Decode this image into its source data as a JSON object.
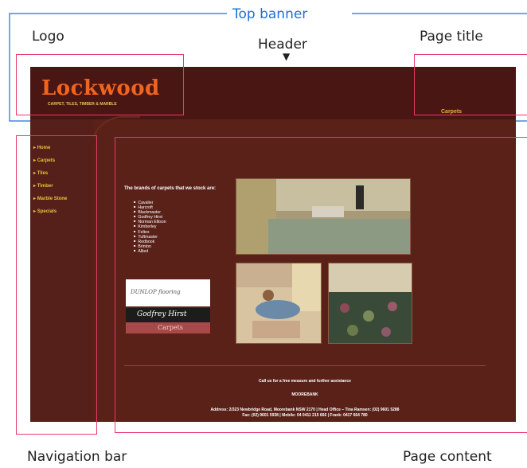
{
  "annotations": {
    "top_banner": "Top banner",
    "logo": "Logo",
    "header": "Header",
    "page_title": "Page title",
    "navigation_bar": "Navigation bar",
    "page_content": "Page content",
    "header_arrow": "▼"
  },
  "site": {
    "logo_name": "Lockwood",
    "logo_tagline": "CARPET, TILES, TIMBER & MARBLE",
    "page_title": "Carpets"
  },
  "nav": {
    "items": [
      "Home",
      "Carpets",
      "Tiles",
      "Timber",
      "Marble Stone",
      "Specials"
    ]
  },
  "content": {
    "intro": "The brands of carpets that we stock are:",
    "brands": [
      "Cavalier",
      "Harcroft",
      "Blackmaster",
      "Godfrey Hirst",
      "Norman Ellison",
      "Kimberley",
      "Feltex",
      "Tuftmaster",
      "Redbook",
      "Brinton",
      "Allied"
    ],
    "dunlop_label": "DUNLOP flooring",
    "godfrey_label": "Godfrey Hirst",
    "carpets_button": "Carpets",
    "cta": "Call us for a free measure and further assistance",
    "company": "MOOREBANK",
    "address_line": "Address: 2/323 Newbridge Road, Moorebank NSW 2170 | Head Office – Tina Ramsen: (02) 9601 5288",
    "contact_line": "Fax: (02) 9601 5938 | Mobile: 04 0411 215 666 | Frank: 0417 664 780"
  },
  "colors": {
    "annotation_box": "#e63a6a",
    "top_banner_box": "#1e6fd9",
    "site_background": "#5a2119",
    "logo_orange": "#f0641e",
    "nav_gold": "#e8c040"
  }
}
